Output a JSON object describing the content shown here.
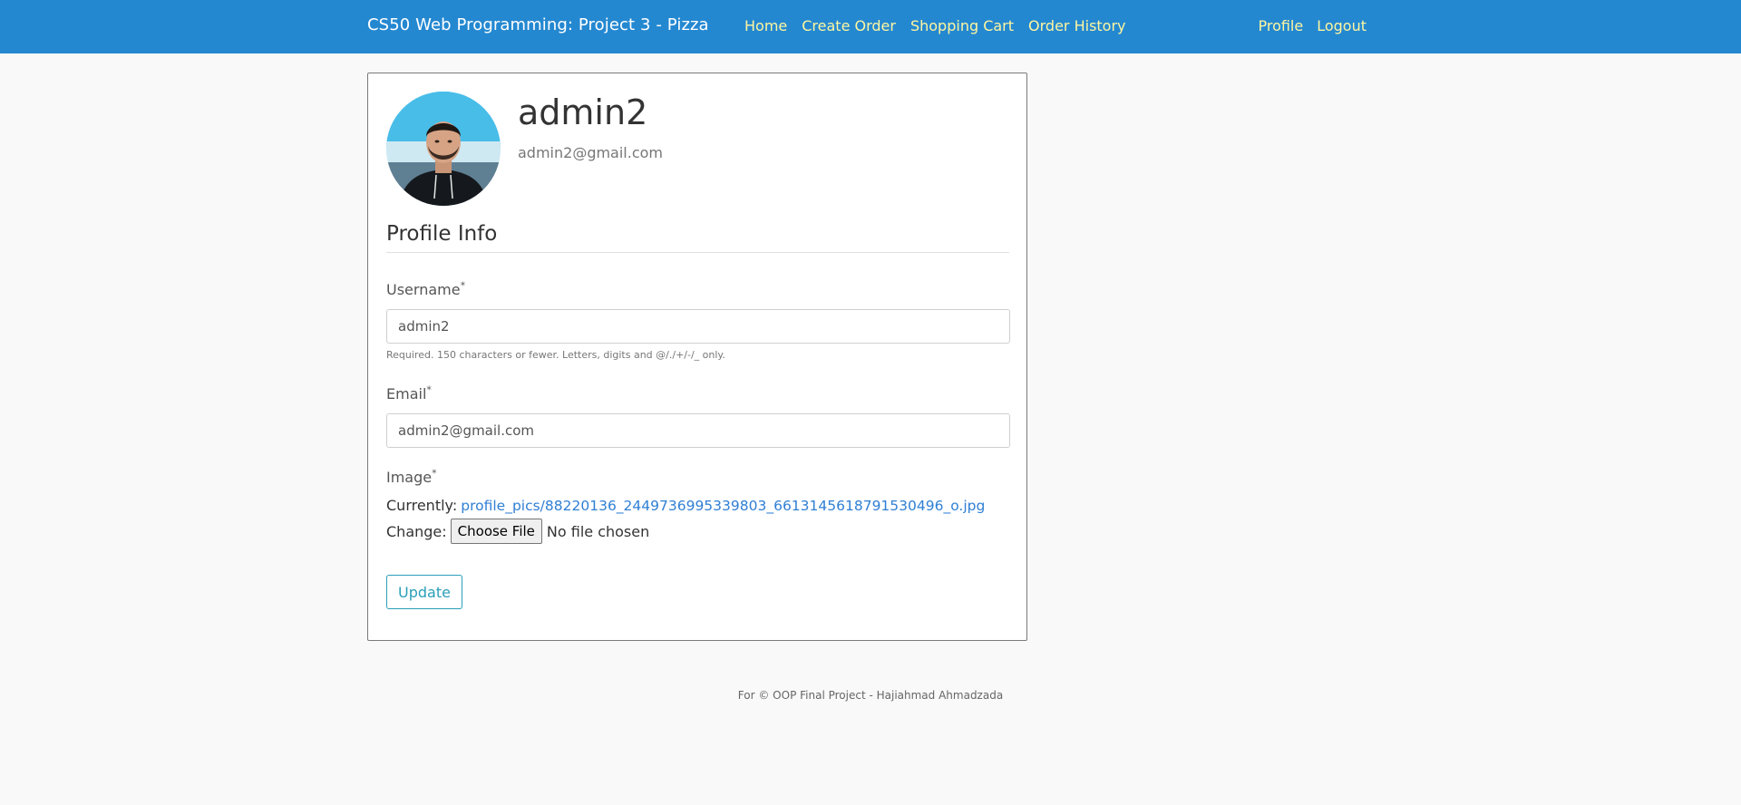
{
  "navbar": {
    "brand": "CS50 Web Programming: Project 3 - Pizza",
    "links": [
      "Home",
      "Create Order",
      "Shopping Cart",
      "Order History"
    ],
    "right_links": [
      "Profile",
      "Logout"
    ],
    "link_color": "#fdf6a0",
    "background": "#2488d1"
  },
  "profile": {
    "avatar_icon": "user-photo",
    "username": "admin2",
    "email": "admin2@gmail.com"
  },
  "form": {
    "section_title": "Profile Info",
    "username_label": "Username",
    "username_value": "admin2",
    "username_help": "Required. 150 characters or fewer. Letters, digits and @/./+/-/_ only.",
    "email_label": "Email",
    "email_value": "admin2@gmail.com",
    "required_mark": "*",
    "image_label": "Image",
    "currently_label": "Currently:",
    "current_file": "profile_pics/88220136_2449736995339803_6613145618791530496_o.jpg",
    "change_label": "Change:",
    "choose_file": "Choose File",
    "no_file": "No file chosen",
    "update_button": "Update"
  },
  "footer": {
    "text": "For © OOP Final Project - Hajiahmad Ahmadzada"
  }
}
